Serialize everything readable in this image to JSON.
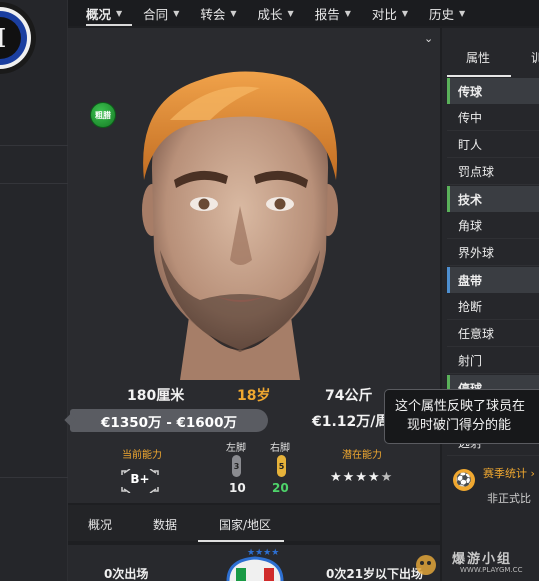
{
  "nav": {
    "items": [
      {
        "label": "概况",
        "active": true
      },
      {
        "label": "合同",
        "active": false
      },
      {
        "label": "转会",
        "active": false
      },
      {
        "label": "成长",
        "active": false
      },
      {
        "label": "报告",
        "active": false
      },
      {
        "label": "对比",
        "active": false
      },
      {
        "label": "历史",
        "active": false
      }
    ]
  },
  "player": {
    "position_badge": "粗腊",
    "height": "180厘米",
    "age": "18岁",
    "weight": "74公斤",
    "value_range": "€1350万 - €1600万",
    "wage": "€1.12万/周"
  },
  "abilities": {
    "current_label": "当前能力",
    "current_value": "B+",
    "left_foot_label": "左脚",
    "left_foot_icon": "3",
    "left_foot_value": "10",
    "right_foot_label": "右脚",
    "right_foot_icon": "5",
    "right_foot_value": "20",
    "potential_label": "潜在能力",
    "potential_stars": "★★★★★",
    "potential_star_rating": 4.5
  },
  "bottom_tabs": [
    "概况",
    "数据",
    "国家/地区"
  ],
  "bottom_row": {
    "left_text": "0次出场",
    "right_text": "0次21岁以下出场"
  },
  "right_panel": {
    "tabs": [
      "属性",
      "训"
    ],
    "attributes": [
      {
        "label": "传球",
        "type": "group green"
      },
      {
        "label": "传中",
        "type": "sub"
      },
      {
        "label": "盯人",
        "type": "sub"
      },
      {
        "label": "罚点球",
        "type": "sub"
      },
      {
        "label": "技术",
        "type": "group green"
      },
      {
        "label": "角球",
        "type": "sub"
      },
      {
        "label": "界外球",
        "type": "sub"
      },
      {
        "label": "盘带",
        "type": "group blue"
      },
      {
        "label": "抢断",
        "type": "sub"
      },
      {
        "label": "任意球",
        "type": "sub"
      },
      {
        "label": "射门",
        "type": "sub"
      },
      {
        "label": "停球",
        "type": "group green"
      },
      {
        "label": "远射",
        "type": "sub"
      }
    ],
    "season_title": "赛季统计 ›",
    "season_sub": "非正式比"
  },
  "tooltip": {
    "line1": "这个属性反映了球员在",
    "line2": "现时破门得分的能"
  },
  "watermark": {
    "text": "爆游小组",
    "url": "WWW.PLAYGM.CC"
  },
  "colors": {
    "accent_orange": "#f0a830",
    "green": "#5ab15a",
    "blue": "#4e8fd0",
    "right_foot_green": "#4ed36a"
  }
}
